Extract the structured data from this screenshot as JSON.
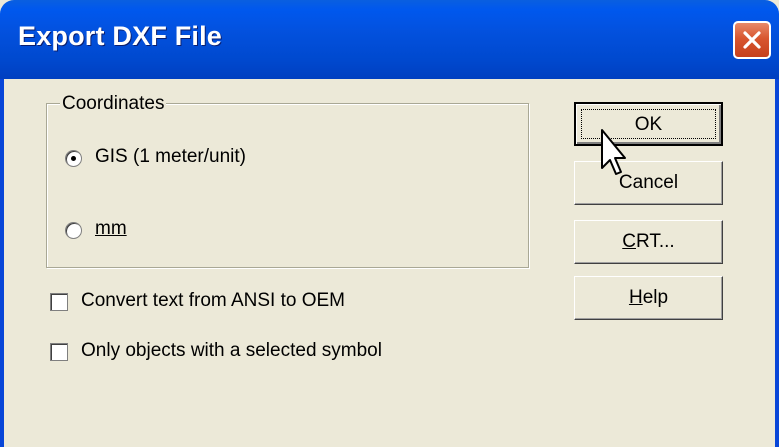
{
  "window": {
    "title": "Export DXF File"
  },
  "coordinates": {
    "label": "Coordinates",
    "options": [
      {
        "label": "GIS (1 meter/unit)",
        "selected": true
      },
      {
        "label_underlined": "mm",
        "selected": false
      }
    ]
  },
  "checkboxes": [
    {
      "label": "Convert text from ANSI to OEM",
      "checked": false
    },
    {
      "label": "Only objects with a selected symbol",
      "checked": false
    }
  ],
  "buttons": {
    "ok": "OK",
    "cancel": "Cancel",
    "crt_mnemonic": "C",
    "crt_rest": "RT...",
    "help_mnemonic": "H",
    "help_rest": "elp"
  },
  "icons": {
    "close": "close-icon",
    "cursor": "mouse-pointer-icon"
  }
}
